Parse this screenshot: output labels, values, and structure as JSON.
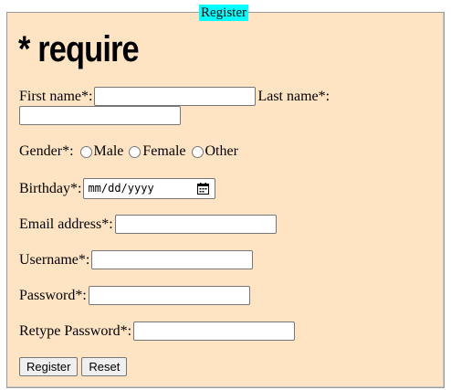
{
  "legend": "Register",
  "heading": "* require",
  "fields": {
    "first_name_label": "First name*:",
    "last_name_label": "Last name*:",
    "gender_label": "Gender*:",
    "gender_options": [
      "Male",
      "Female",
      "Other"
    ],
    "birthday_label": "Birthday*:",
    "birthday_placeholder": "mm/dd/yyyy",
    "email_label": "Email address*:",
    "username_label": "Username*:",
    "password_label": "Password*:",
    "retype_password_label": "Retype Password*:"
  },
  "buttons": {
    "register": "Register",
    "reset": "Reset"
  }
}
